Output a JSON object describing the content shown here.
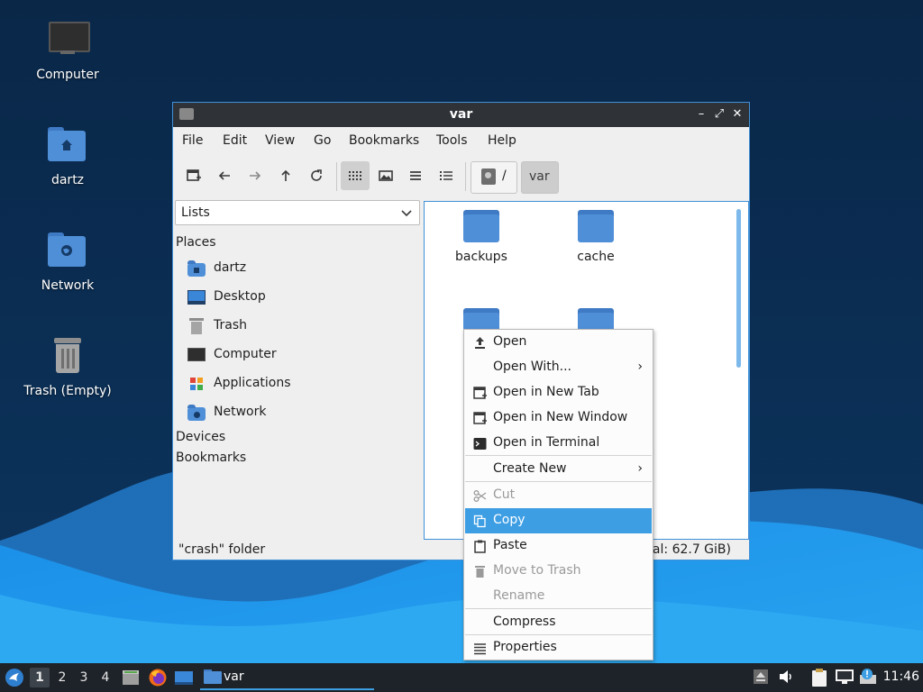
{
  "desktop": {
    "icons": [
      {
        "label": "Computer",
        "icon": "computer-icon"
      },
      {
        "label": "dartz",
        "icon": "home-folder-icon"
      },
      {
        "label": "Network",
        "icon": "network-folder-icon"
      },
      {
        "label": "Trash (Empty)",
        "icon": "trash-icon"
      }
    ]
  },
  "window": {
    "title": "var",
    "controls": {
      "minimize": "–",
      "maximize": "⤢",
      "close": "✕"
    },
    "menubar": [
      "File",
      "Edit",
      "View",
      "Go",
      "Bookmarks",
      "Tools",
      "Help"
    ],
    "toolbar": {
      "buttons": [
        "new-tab-icon",
        "back-icon",
        "forward-icon",
        "up-icon",
        "reload-icon",
        "icon-view-icon",
        "compact-view-icon",
        "detailed-list-icon",
        "list-view-icon"
      ]
    },
    "path": {
      "root": "/",
      "current": "var"
    },
    "sidepane": {
      "selector": "Lists",
      "places_heading": "Places",
      "places": [
        {
          "label": "dartz",
          "icon": "home-folder-icon"
        },
        {
          "label": "Desktop",
          "icon": "desktop-icon"
        },
        {
          "label": "Trash",
          "icon": "trash-icon"
        },
        {
          "label": "Computer",
          "icon": "computer-icon"
        },
        {
          "label": "Applications",
          "icon": "applications-icon"
        },
        {
          "label": "Network",
          "icon": "network-folder-icon"
        }
      ],
      "devices_heading": "Devices",
      "bookmarks_heading": "Bookmarks"
    },
    "files": [
      {
        "name": "backups",
        "icon": "folder-icon"
      },
      {
        "name": "cache",
        "icon": "folder-icon"
      },
      {
        "name": "",
        "icon": "folder-icon"
      },
      {
        "name": "",
        "icon": "folder-icon"
      }
    ],
    "status": {
      "left": "\"crash\" folder",
      "right": "tal: 62.7 GiB)"
    }
  },
  "context_menu": {
    "items": [
      {
        "label": "Open",
        "icon": "open-icon",
        "enabled": true
      },
      {
        "label": "Open With...",
        "icon": "",
        "enabled": true,
        "submenu": "›"
      },
      {
        "label": "Open in New Tab",
        "icon": "new-tab-icon",
        "enabled": true
      },
      {
        "label": "Open in New Window",
        "icon": "new-window-icon",
        "enabled": true
      },
      {
        "label": "Open in Terminal",
        "icon": "terminal-icon",
        "enabled": true
      },
      {
        "label": "Create New",
        "icon": "",
        "enabled": true,
        "submenu": "›"
      },
      {
        "label": "Cut",
        "icon": "scissors-icon",
        "enabled": false
      },
      {
        "label": "Copy",
        "icon": "copy-icon",
        "enabled": true,
        "highlighted": true
      },
      {
        "label": "Paste",
        "icon": "paste-icon",
        "enabled": true
      },
      {
        "label": "Move to Trash",
        "icon": "trash-icon",
        "enabled": false
      },
      {
        "label": "Rename",
        "icon": "",
        "enabled": false
      },
      {
        "label": "Compress",
        "icon": "",
        "enabled": true
      },
      {
        "label": "Properties",
        "icon": "properties-icon",
        "enabled": true
      }
    ]
  },
  "taskbar": {
    "workspaces": [
      "1",
      "2",
      "3",
      "4"
    ],
    "active_workspace": "1",
    "task": "var",
    "clock": "11:46"
  },
  "colors": {
    "accent": "#3d9ee4",
    "titlebar": "#2f3338",
    "taskbar": "#1e2329",
    "folder": "#4f8fd8"
  }
}
